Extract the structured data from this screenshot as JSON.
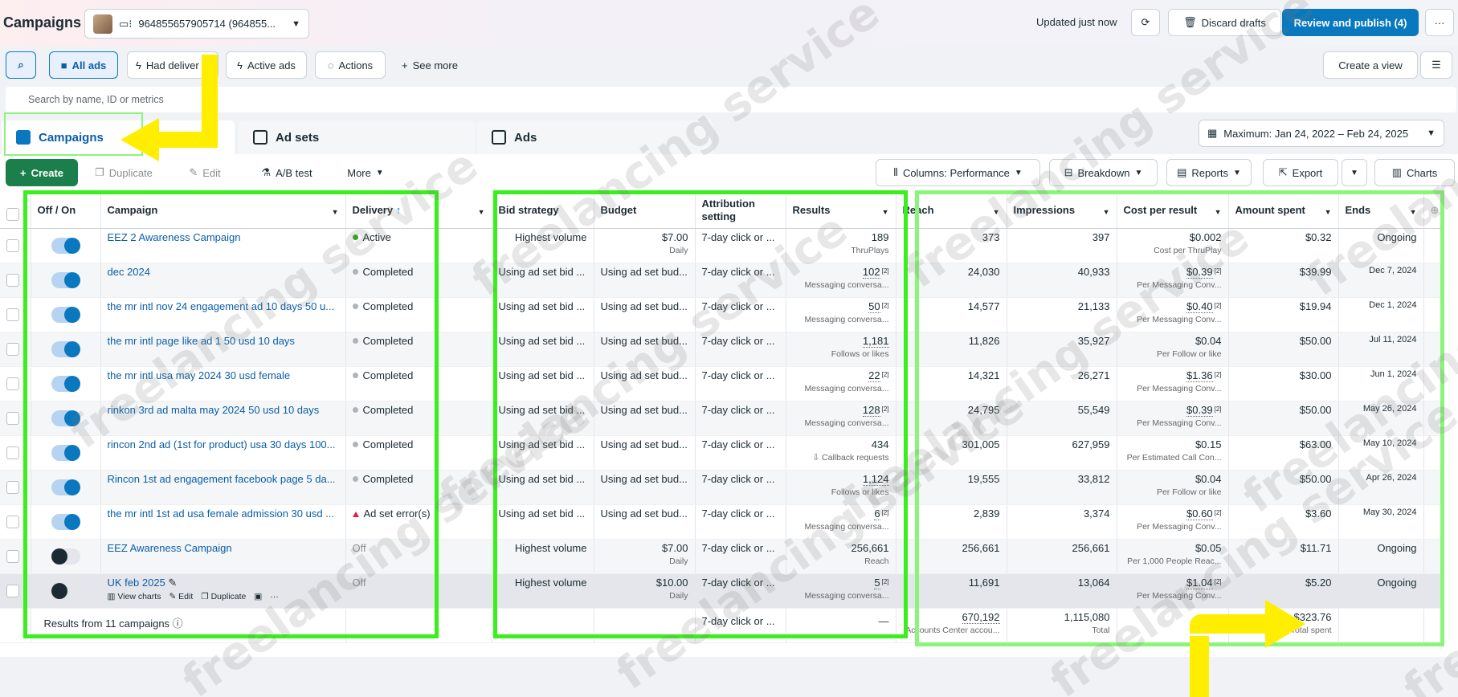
{
  "header": {
    "title": "Campaigns",
    "account_id": "964855657905714 (964855...",
    "updated": "Updated just now",
    "discard_label": "Discard drafts",
    "review_label": "Review and publish (4)",
    "more_label": "···"
  },
  "filters": {
    "all_ads": "All ads",
    "had_delivery": "Had deliver",
    "active_ads": "Active ads",
    "actions": "Actions",
    "see_more": "See more",
    "create_view": "Create a view"
  },
  "search": {
    "placeholder": "Search by name, ID or metrics"
  },
  "tabs": {
    "campaigns": "Campaigns",
    "ad_sets": "Ad sets",
    "ads": "Ads"
  },
  "date_range": "Maximum: Jan 24, 2022 – Feb 24, 2025",
  "toolbar": {
    "create": "Create",
    "duplicate": "Duplicate",
    "edit": "Edit",
    "ab_test": "A/B test",
    "more": "More",
    "columns": "Columns: Performance",
    "breakdown": "Breakdown",
    "reports": "Reports",
    "export": "Export",
    "charts": "Charts"
  },
  "columns": {
    "onoff": "Off / On",
    "campaign": "Campaign",
    "delivery": "Delivery",
    "bid": "Bid strategy",
    "budget": "Budget",
    "attribution": "Attribution setting",
    "results": "Results",
    "reach": "Reach",
    "impressions": "Impressions",
    "cpr": "Cost per result",
    "spent": "Amount spent",
    "ends": "Ends"
  },
  "rows": [
    {
      "on": true,
      "name": "EEZ 2 Awareness Campaign",
      "status": "Active",
      "status_type": "green",
      "bid": "Highest volume",
      "bid_align": "right",
      "budget": "$7.00",
      "budget_sub": "Daily",
      "attr": "7-day click or ...",
      "results": "189",
      "results_sub": "ThruPlays",
      "reach": "373",
      "impr": "397",
      "cpr": "$0.002",
      "cpr_sub": "Cost per ThruPlay",
      "spent": "$0.32",
      "ends": "Ongoing"
    },
    {
      "on": true,
      "name": "dec 2024",
      "status": "Completed",
      "status_type": "gray",
      "bid": "Using ad set bid ...",
      "bid_align": "left",
      "budget": "Using ad set bud...",
      "budget_sub": "",
      "attr": "7-day click or ...",
      "results": "102",
      "results_sub": "Messaging conversa...",
      "reach": "24,030",
      "impr": "40,933",
      "cpr": "$0.39",
      "cpr_sub": "Per Messaging Conv...",
      "spent": "$39.99",
      "ends": "Dec 7, 2024"
    },
    {
      "on": true,
      "name": "the mr intl nov 24 engagement ad 10 days 50 u...",
      "status": "Completed",
      "status_type": "gray",
      "bid": "Using ad set bid ...",
      "bid_align": "left",
      "budget": "Using ad set bud...",
      "budget_sub": "",
      "attr": "7-day click or ...",
      "results": "50",
      "results_sub": "Messaging conversa...",
      "reach": "14,577",
      "impr": "21,133",
      "cpr": "$0.40",
      "cpr_sub": "Per Messaging Conv...",
      "spent": "$19.94",
      "ends": "Dec 1, 2024"
    },
    {
      "on": true,
      "name": "the mr intl page like ad 1 50 usd 10 days",
      "status": "Completed",
      "status_type": "gray",
      "bid": "Using ad set bid ...",
      "bid_align": "left",
      "budget": "Using ad set bud...",
      "budget_sub": "",
      "attr": "7-day click or ...",
      "results": "1,181",
      "results_sub": "Follows or likes",
      "reach": "11,826",
      "impr": "35,927",
      "cpr": "$0.04",
      "cpr_sub": "Per Follow or like",
      "spent": "$50.00",
      "ends": "Jul 11, 2024"
    },
    {
      "on": true,
      "name": "the mr intl usa may 2024 30 usd female",
      "status": "Completed",
      "status_type": "gray",
      "bid": "Using ad set bid ...",
      "bid_align": "left",
      "budget": "Using ad set bud...",
      "budget_sub": "",
      "attr": "7-day click or ...",
      "results": "22",
      "results_sub": "Messaging conversa...",
      "reach": "14,321",
      "impr": "26,271",
      "cpr": "$1.36",
      "cpr_sub": "Per Messaging Conv...",
      "spent": "$30.00",
      "ends": "Jun 1, 2024"
    },
    {
      "on": true,
      "name": "rinkon 3rd ad malta may 2024 50 usd 10 days",
      "status": "Completed",
      "status_type": "gray",
      "bid": "Using ad set bid ...",
      "bid_align": "left",
      "budget": "Using ad set bud...",
      "budget_sub": "",
      "attr": "7-day click or ...",
      "results": "128",
      "results_sub": "Messaging conversa...",
      "reach": "24,795",
      "impr": "55,549",
      "cpr": "$0.39",
      "cpr_sub": "Per Messaging Conv...",
      "spent": "$50.00",
      "ends": "May 26, 2024"
    },
    {
      "on": true,
      "name": "rincon 2nd ad (1st for product) usa 30 days 100...",
      "status": "Completed",
      "status_type": "gray",
      "bid": "Using ad set bid ...",
      "bid_align": "left",
      "budget": "Using ad set bud...",
      "budget_sub": "",
      "attr": "7-day click or ...",
      "results": "434",
      "results_sub": "Callback requests",
      "reach": "301,005",
      "impr": "627,959",
      "cpr": "$0.15",
      "cpr_sub": "Per Estimated Call Con...",
      "spent": "$63.00",
      "ends": "May 10, 2024"
    },
    {
      "on": true,
      "name": "Rincon 1st ad engagement facebook page 5 da...",
      "status": "Completed",
      "status_type": "gray",
      "bid": "Using ad set bid ...",
      "bid_align": "left",
      "budget": "Using ad set bud...",
      "budget_sub": "",
      "attr": "7-day click or ...",
      "results": "1,124",
      "results_sub": "Follows or likes",
      "reach": "19,555",
      "impr": "33,812",
      "cpr": "$0.04",
      "cpr_sub": "Per Follow or like",
      "spent": "$50.00",
      "ends": "Apr 26, 2024"
    },
    {
      "on": true,
      "name": "the mr intl 1st ad usa female admission 30 usd ...",
      "status": "Ad set error(s)",
      "status_type": "error",
      "bid": "Using ad set bid ...",
      "bid_align": "left",
      "budget": "Using ad set bud...",
      "budget_sub": "",
      "attr": "7-day click or ...",
      "results": "6",
      "results_sub": "Messaging conversa...",
      "reach": "2,839",
      "impr": "3,374",
      "cpr": "$0.60",
      "cpr_sub": "Per Messaging Conv...",
      "spent": "$3.60",
      "ends": "May 30, 2024"
    },
    {
      "on": false,
      "name": "EEZ Awareness Campaign",
      "status": "Off",
      "status_type": "off",
      "bid": "Highest volume",
      "bid_align": "right",
      "budget": "$7.00",
      "budget_sub": "Daily",
      "attr": "7-day click or ...",
      "results": "256,661",
      "results_sub": "Reach",
      "reach": "256,661",
      "impr": "256,661",
      "cpr": "$0.05",
      "cpr_sub": "Per 1,000 People Reac...",
      "spent": "$11.71",
      "ends": "Ongoing"
    },
    {
      "on": false,
      "name": "UK feb 2025",
      "status": "Off",
      "status_type": "off",
      "bid": "Highest volume",
      "bid_align": "right",
      "budget": "$10.00",
      "budget_sub": "Daily",
      "attr": "7-day click or ...",
      "results": "5",
      "results_sub": "Messaging conversa...",
      "reach": "11,691",
      "impr": "13,064",
      "cpr": "$1.04",
      "cpr_sub": "Per Messaging Conv...",
      "spent": "$5.20",
      "ends": "Ongoing"
    }
  ],
  "row_actions": {
    "view_charts": "View charts",
    "edit": "Edit",
    "duplicate": "Duplicate"
  },
  "totals": {
    "label": "Results from 11 campaigns",
    "attr": "7-day click or ...",
    "results": "—",
    "reach": "670,192",
    "reach_sub": "Accounts Center accou...",
    "impr": "1,115,080",
    "impr_sub": "Total",
    "spent": "$323.76",
    "spent_sub": "Total spent"
  },
  "watermark": "freelancing service"
}
